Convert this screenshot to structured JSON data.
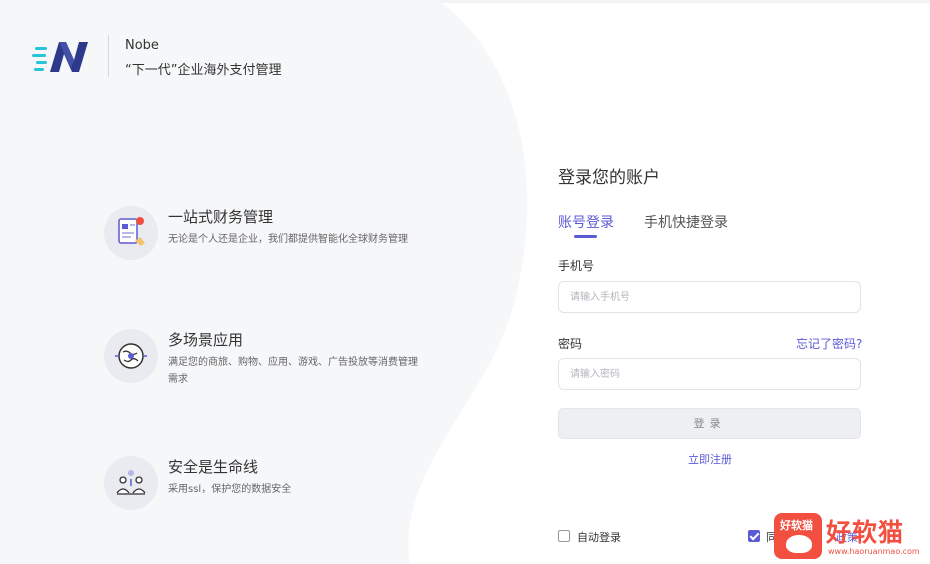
{
  "brand": {
    "name": "Nobe",
    "slogan": "“下一代”企业海外支付管理",
    "logo_icon": "nobe-logo-icon",
    "colors": {
      "logo_dark": "#2d3a8c",
      "logo_cyan": "#28c4d8",
      "accent": "#5b5bd6"
    }
  },
  "features": [
    {
      "icon": "finance-document-icon",
      "title": "一站式财务管理",
      "desc": "无论是个人还是企业，我们都提供智能化全球财务管理"
    },
    {
      "icon": "multi-scene-globe-icon",
      "title": "多场景应用",
      "desc": "满足您的商旅、购物、应用、游戏、广告投放等消费管理需求"
    },
    {
      "icon": "security-team-icon",
      "title": "安全是生命线",
      "desc": "采用ssl，保护您的数据安全"
    }
  ],
  "login": {
    "title": "登录您的账户",
    "tabs": [
      {
        "label": "账号登录",
        "active": true
      },
      {
        "label": "手机快捷登录",
        "active": false
      }
    ],
    "phone_label": "手机号",
    "phone_placeholder": "请输入手机号",
    "password_label": "密码",
    "password_placeholder": "请输入密码",
    "forgot_label": "忘记了密码?",
    "submit_label": "登录",
    "register_label": "立即注册",
    "auto_login_label": "自动登录",
    "auto_login_checked": false,
    "agree_prefix": "同",
    "agree_link": "政策",
    "agree_checked": true
  },
  "watermark": {
    "small": "好软猫",
    "big": "好软猫",
    "url": "www.haoruanmao.com",
    "color": "#f24f40"
  }
}
